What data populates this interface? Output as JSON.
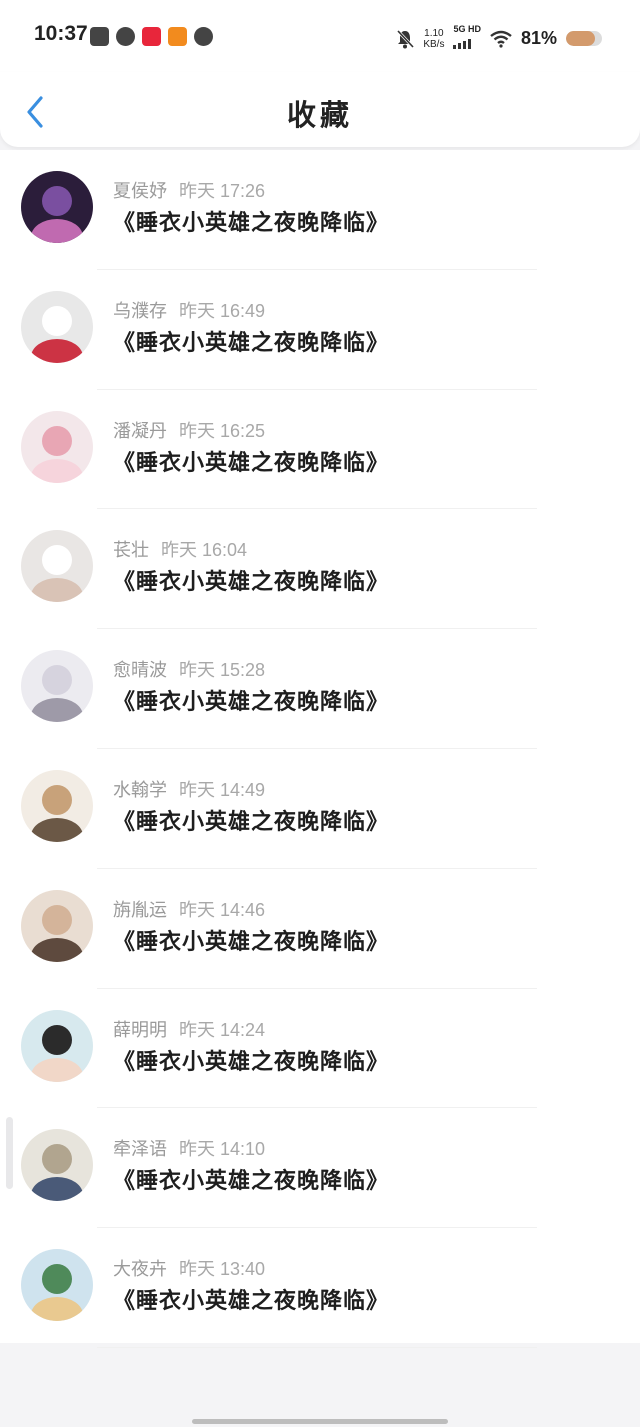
{
  "status_bar": {
    "time": "10:37",
    "net_speed_value": "1.10",
    "net_speed_unit": "KB/s",
    "signal_label": "5G HD",
    "battery_percent": "81%",
    "battery_level": 0.81,
    "icons": [
      "mail-icon",
      "link-icon",
      "xiaohongshu-icon",
      "taobao-icon",
      "chat-bubble-icon",
      "mute-bell-icon",
      "signal-bars-icon",
      "wifi-icon",
      "battery-icon"
    ]
  },
  "header": {
    "title": "收藏",
    "back_icon": "chevron-left-icon",
    "accent_color": "#3a8fe0"
  },
  "favorites": [
    {
      "name": "夏侯妤",
      "time": "昨天 17:26",
      "title": "《睡衣小英雄之夜晚降临》"
    },
    {
      "name": "乌濮存",
      "time": "昨天 16:49",
      "title": "《睡衣小英雄之夜晚降临》"
    },
    {
      "name": "潘凝丹",
      "time": "昨天 16:25",
      "title": "《睡衣小英雄之夜晚降临》"
    },
    {
      "name": "苌壮",
      "time": "昨天 16:04",
      "title": "《睡衣小英雄之夜晚降临》"
    },
    {
      "name": "愈晴波",
      "time": "昨天 15:28",
      "title": "《睡衣小英雄之夜晚降临》"
    },
    {
      "name": "水翰学",
      "time": "昨天 14:49",
      "title": "《睡衣小英雄之夜晚降临》"
    },
    {
      "name": "旃胤运",
      "time": "昨天 14:46",
      "title": "《睡衣小英雄之夜晚降临》"
    },
    {
      "name": "薛明明",
      "time": "昨天 14:24",
      "title": "《睡衣小英雄之夜晚降临》"
    },
    {
      "name": "牵泽语",
      "time": "昨天 14:10",
      "title": "《睡衣小英雄之夜晚降临》"
    },
    {
      "name": "大夜卉",
      "time": "昨天 13:40",
      "title": "《睡衣小英雄之夜晚降临》"
    }
  ]
}
